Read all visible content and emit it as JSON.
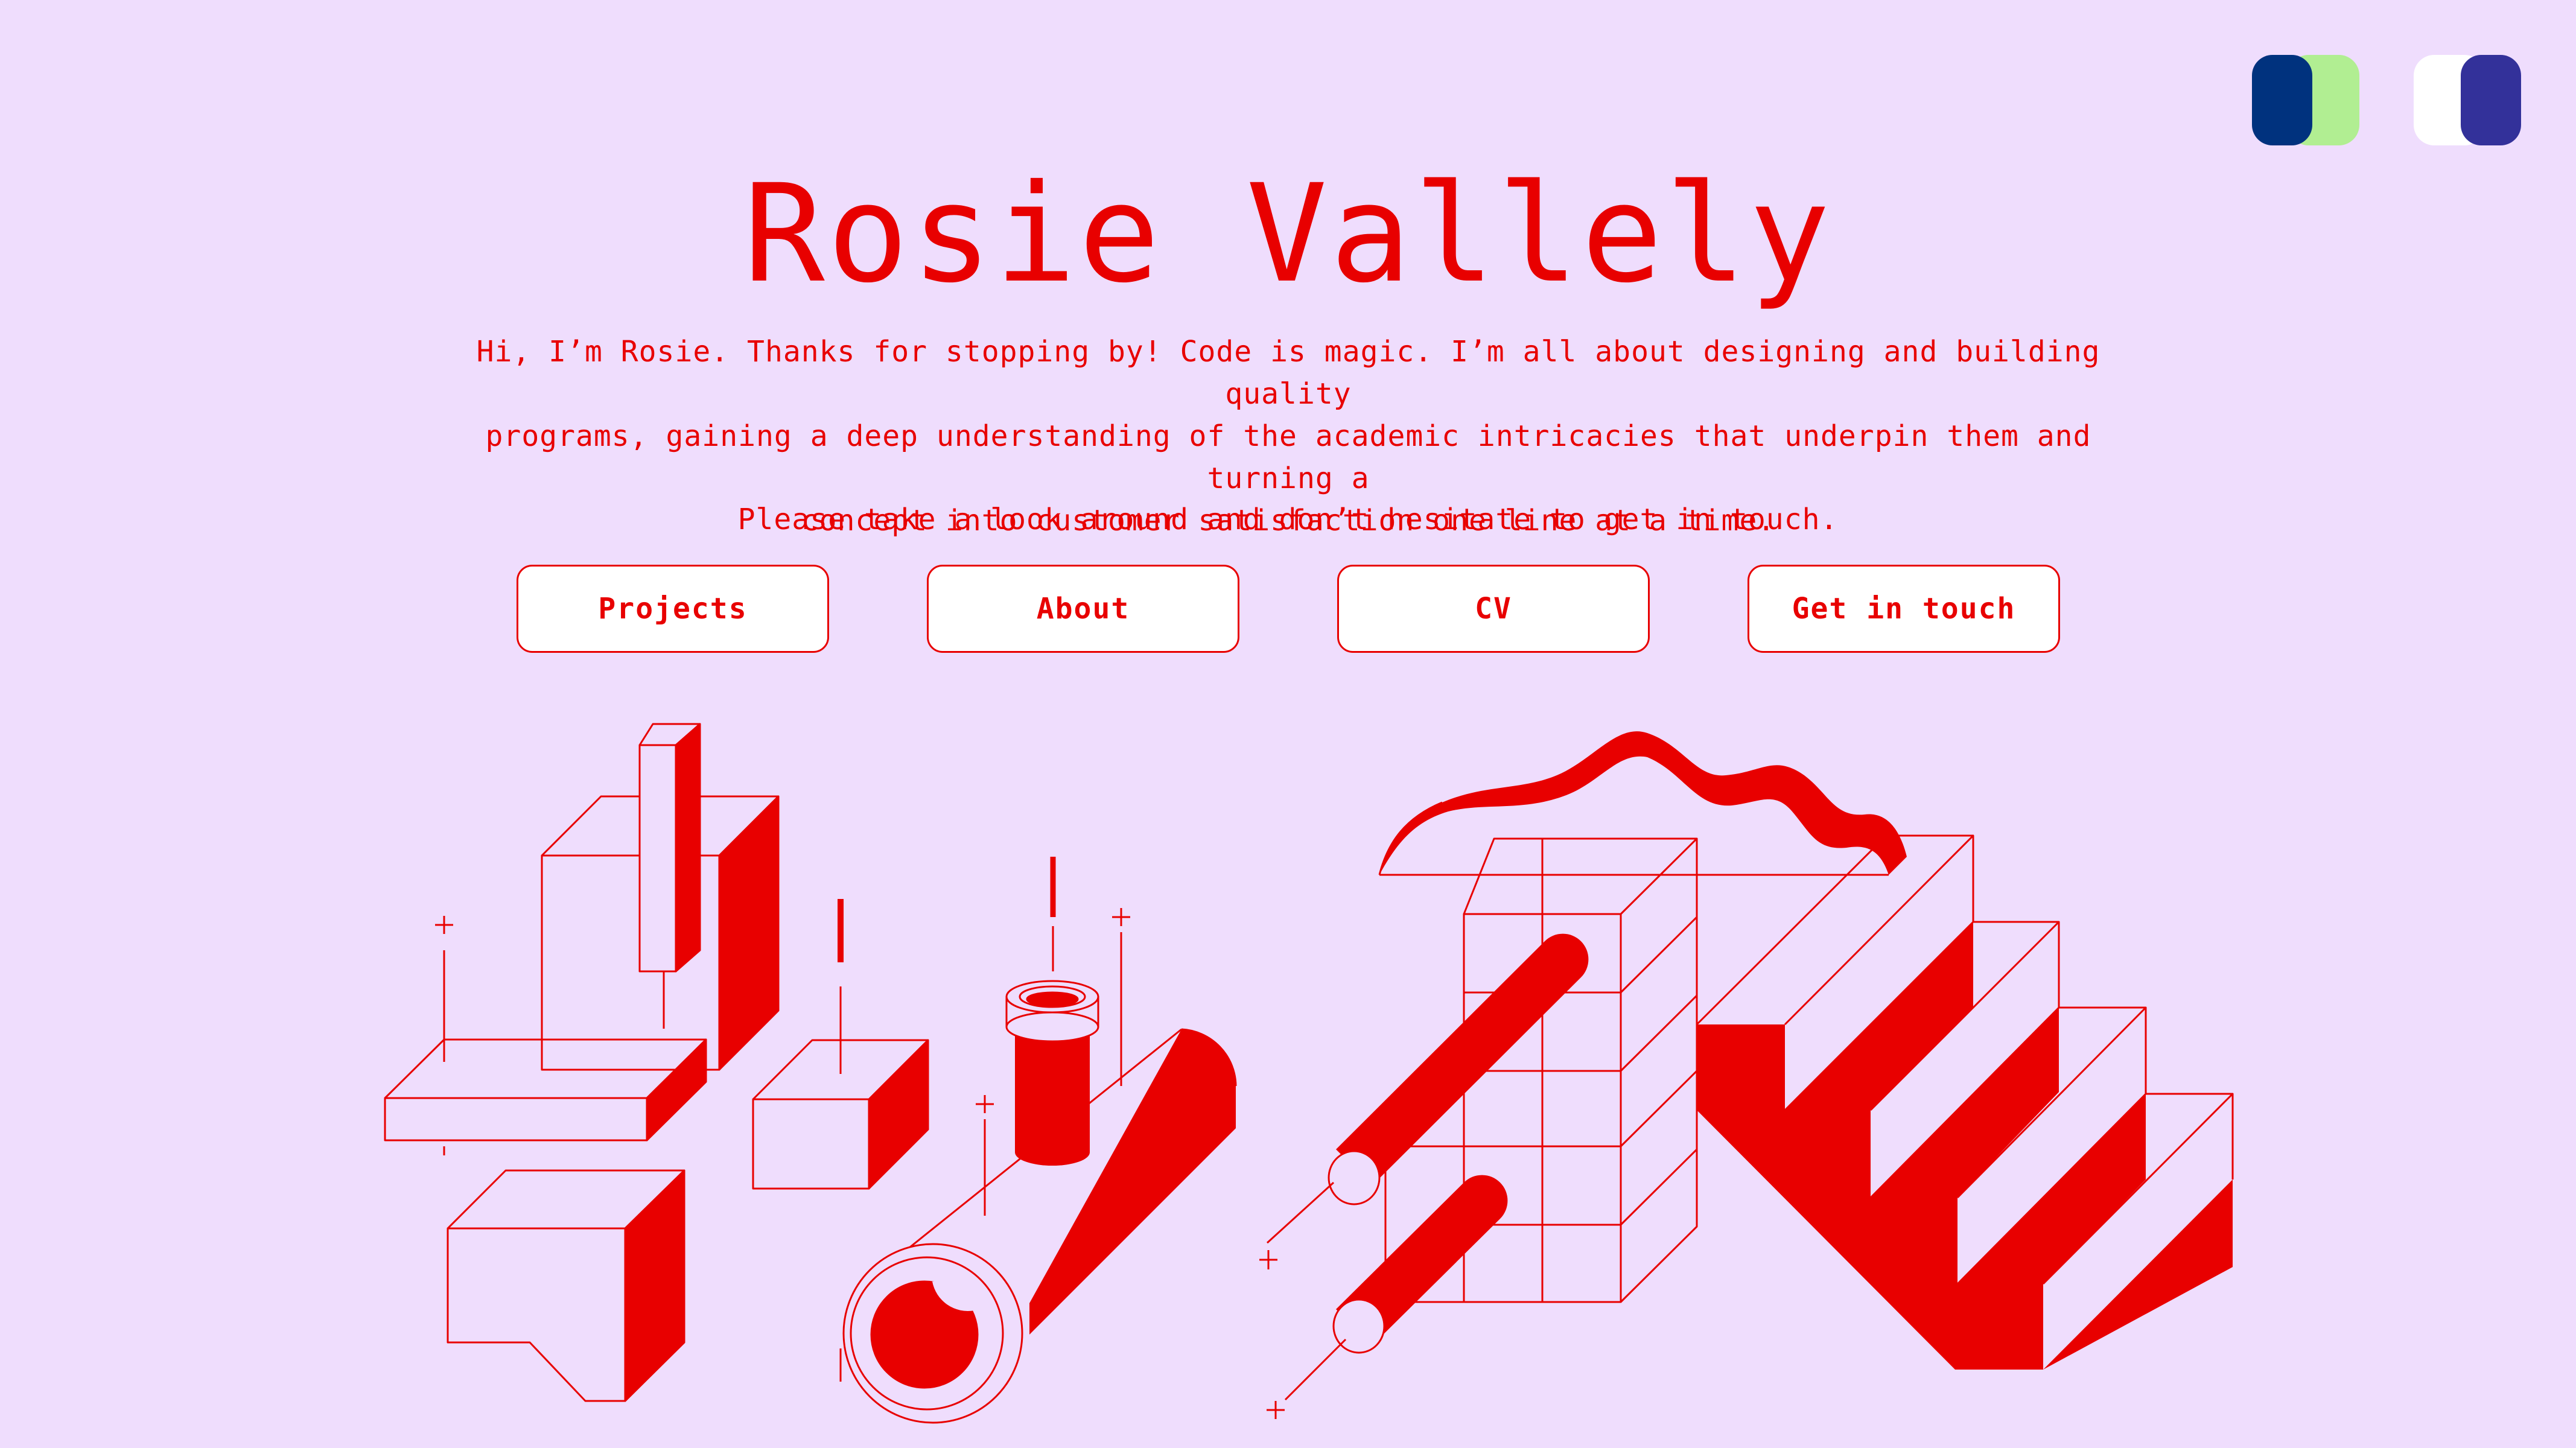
{
  "theme_toggles": [
    {
      "label": "",
      "colors": [
        "#00327E",
        "#B1EE92"
      ]
    },
    {
      "label": "",
      "colors": [
        "#FFFFFF",
        "#33319A"
      ]
    }
  ],
  "hero": {
    "title": "Rosie Vallely",
    "intro_lines": [
      "Hi, I’m Rosie. Thanks for stopping by! Code is magic. I’m all about designing and building quality",
      "programs, gaining a deep understanding of the academic intricacies that underpin them and turning a",
      "concept into customer satisfaction one line at a time."
    ],
    "invite": "Please take a look around and don’t hesitate to get in touch."
  },
  "nav": {
    "projects": "Projects",
    "about": "About",
    "cv": "CV",
    "contact": "Get in touch"
  },
  "colors": {
    "background": "#EFDDFD",
    "accent": "#E80000",
    "button_bg": "#FFFFFF"
  }
}
